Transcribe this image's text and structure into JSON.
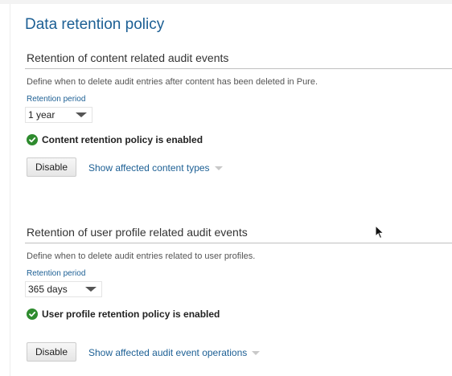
{
  "page": {
    "title": "Data retention policy"
  },
  "content_section": {
    "title": "Retention of content related audit events",
    "description": "Define when to delete audit entries after content has been deleted in Pure.",
    "field_label": "Retention period",
    "retention_value": "1 year",
    "status_text": "Content retention policy is enabled",
    "disable_label": "Disable",
    "link_label": "Show affected content types"
  },
  "user_section": {
    "title": "Retention of user profile related audit events",
    "description": "Define when to delete audit entries related to user profiles.",
    "field_label": "Retention period",
    "retention_value": "365 days",
    "status_text": "User profile retention policy is enabled",
    "disable_label": "Disable",
    "link_label": "Show affected audit event operations"
  },
  "colors": {
    "heading_blue": "#1c5f94",
    "success_green": "#2e8b2e"
  },
  "icons": {
    "status": "check-circle-icon",
    "dropdown": "chevron-down-icon",
    "pointer": "mouse-pointer-icon"
  }
}
